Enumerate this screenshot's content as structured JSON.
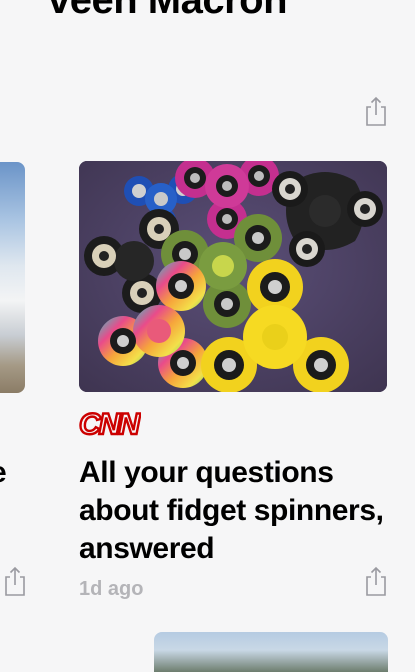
{
  "section": {
    "title": "veen Macron"
  },
  "cards": [
    {
      "image_desc": "",
      "headline_tail": "e"
    },
    {
      "source": "CNN",
      "headline": "All your questions about fidget spinners, answered",
      "time": "1d ago"
    }
  ],
  "icons": {
    "share": "share-icon"
  },
  "colors": {
    "background": "#f6f6f7",
    "source_brand": "#cc0000",
    "timestamp": "#b4b4b8",
    "share_icon": "#9a9aa0"
  }
}
